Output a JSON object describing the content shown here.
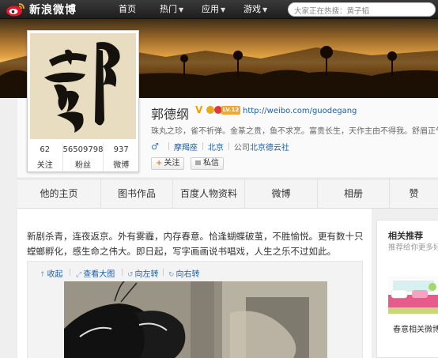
{
  "topbar": {
    "logo_text": "新浪微博",
    "nav": {
      "home": "首页",
      "hot": "热门",
      "apps": "应用",
      "games": "游戏"
    },
    "search_placeholder": "大家正在热搜：黄子韬"
  },
  "profile": {
    "name": "郭德纲",
    "url": "http://weibo.com/guodegang",
    "vip_badge": "LV.12",
    "description": "珠丸之珍，雀不祈弹。金篆之贵，鱼不求烹。富贵长生，天作主由不得我。舒眉正气，我",
    "location": "北京",
    "tag_label": "摩羯座",
    "company_prefix": "公司",
    "company": "北京德云社",
    "stats": [
      {
        "value": "62",
        "label": "关注"
      },
      {
        "value": "56509798",
        "label": "粉丝"
      },
      {
        "value": "937",
        "label": "微博"
      }
    ],
    "follow_label": "关注",
    "message_label": "私信"
  },
  "tabs": [
    "他的主页",
    "图书作品",
    "百度人物资料",
    "微博",
    "相册",
    "赞"
  ],
  "post": {
    "text": "新剧杀青，连夜返京。外有雾霾，内存春意。恰逢蝴蝶破茧，不胜愉悦。更有数十只螳螂孵化，感生命之伟大。即日起，写字画画说书唱戏，人生之乐不过如此。",
    "actions": [
      "收起",
      "查看大图",
      "向左转",
      "向右转"
    ]
  },
  "sidebar": {
    "title": "相关推荐",
    "subtitle": "推荐给你更多好微博",
    "item_name": "春意相关微博"
  },
  "colors": {
    "accent_orange": "#f08010",
    "link_blue": "#1f5fa8",
    "topbar_dark": "#1e1e1e"
  }
}
